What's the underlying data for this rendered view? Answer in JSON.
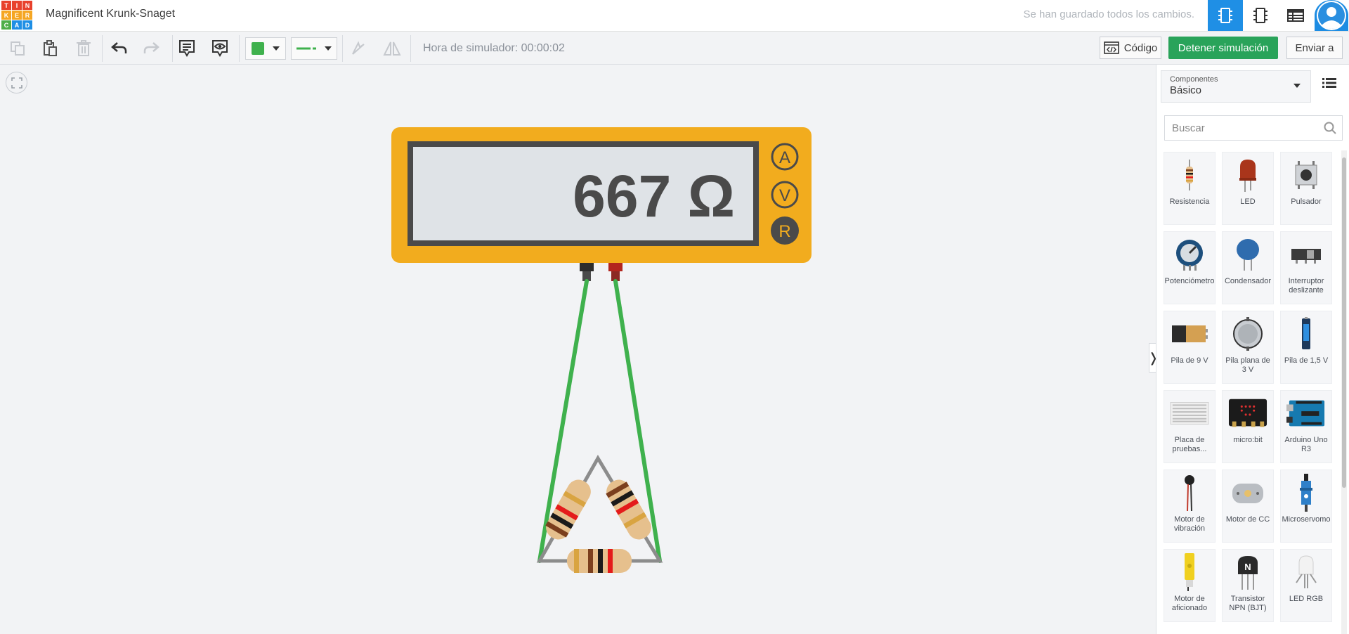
{
  "app": {
    "logo_letters": [
      "T",
      "I",
      "N",
      "K",
      "E",
      "R",
      "C",
      "A",
      "D"
    ],
    "logo_colors": [
      "#e8412c",
      "#e8412c",
      "#e8412c",
      "#f5a623",
      "#f5a623",
      "#f5a623",
      "#4fae4a",
      "#1f8fe5",
      "#1f8fe5"
    ],
    "project_title": "Magnificent Krunk-Snaget",
    "save_status": "Se han guardado todos los cambios.",
    "views": [
      "circuit-view",
      "component-list-view",
      "bom-view"
    ]
  },
  "toolbar": {
    "sim_time_label": "Hora de simulador: 00:00:02",
    "fill_color": "#3fb14d",
    "wire_color": "#3fb14d",
    "code_label": "Código",
    "stop_sim_label": "Detener simulación",
    "send_label": "Enviar a"
  },
  "multimeter": {
    "reading": "667 Ω",
    "modes": [
      "A",
      "V",
      "R"
    ],
    "active_mode": "R",
    "body_color": "#f2ac1e"
  },
  "panel": {
    "components_label": "Componentes",
    "components_value": "Básico",
    "search_placeholder": "Buscar",
    "components": [
      {
        "label": "Resistencia",
        "icon": "resistor-icon"
      },
      {
        "label": "LED",
        "icon": "led-icon"
      },
      {
        "label": "Pulsador",
        "icon": "pushbutton-icon"
      },
      {
        "label": "Potenciómetro",
        "icon": "potentiometer-icon"
      },
      {
        "label": "Condensador",
        "icon": "capacitor-icon"
      },
      {
        "label": "Interruptor deslizante",
        "icon": "slide-switch-icon"
      },
      {
        "label": "Pila de 9 V",
        "icon": "battery-9v-icon"
      },
      {
        "label": "Pila plana de 3 V",
        "icon": "coin-cell-icon"
      },
      {
        "label": "Pila de 1,5 V",
        "icon": "battery-aa-icon"
      },
      {
        "label": "Placa de pruebas...",
        "icon": "breadboard-icon"
      },
      {
        "label": "micro:bit",
        "icon": "microbit-icon"
      },
      {
        "label": "Arduino Uno R3",
        "icon": "arduino-icon"
      },
      {
        "label": "Motor de vibración",
        "icon": "vibration-motor-icon"
      },
      {
        "label": "Motor de CC",
        "icon": "dc-motor-icon"
      },
      {
        "label": "Microservomo",
        "icon": "microservo-icon"
      },
      {
        "label": "Motor de aficionado",
        "icon": "hobby-gearmotor-icon"
      },
      {
        "label": "Transistor NPN (BJT)",
        "icon": "npn-transistor-icon"
      },
      {
        "label": "LED RGB",
        "icon": "rgb-led-icon"
      }
    ]
  }
}
